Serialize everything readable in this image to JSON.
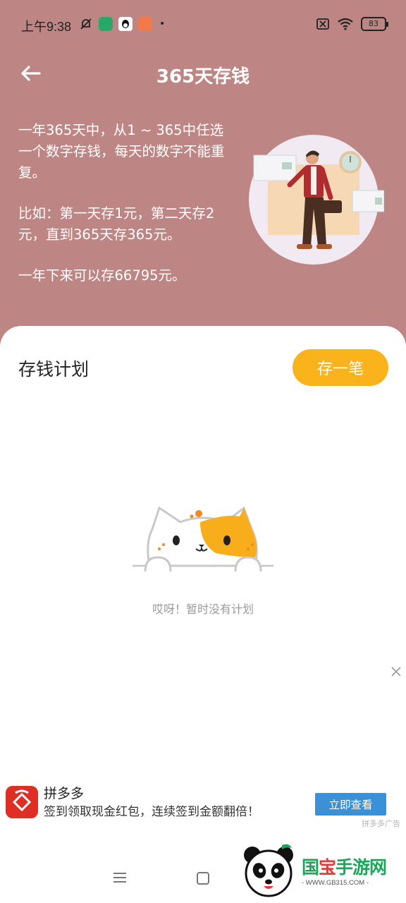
{
  "status_bar": {
    "time": "上午9:38",
    "battery": "83"
  },
  "header": {
    "title": "365天存钱"
  },
  "intro": {
    "paragraph_1": "一年365天中，从1 ~ 365中任选一个数字存钱，每天的数字不能重复。",
    "paragraph_2": "比如：第一天存1元，第二天存2元，直到365天存365元。",
    "paragraph_3": "一年下来可以存66795元。"
  },
  "plan": {
    "title": "存钱计划",
    "save_button": "存一笔",
    "empty_text": "哎呀！暂时没有计划"
  },
  "ad": {
    "name": "拼多多",
    "description": "签到领取现金红包，连续签到金额翻倍！",
    "button": "立即查看",
    "source": "拼多多广告"
  },
  "watermark": {
    "brand_part1": "国",
    "brand_part2": "宝",
    "brand_part3": "手游网",
    "url": "- WWW.GB315.COM -"
  },
  "colors": {
    "header_bg": "#bd8684",
    "accent": "#fbb31c",
    "ad_button": "#3b91d8",
    "ad_logo": "#e02e24"
  }
}
